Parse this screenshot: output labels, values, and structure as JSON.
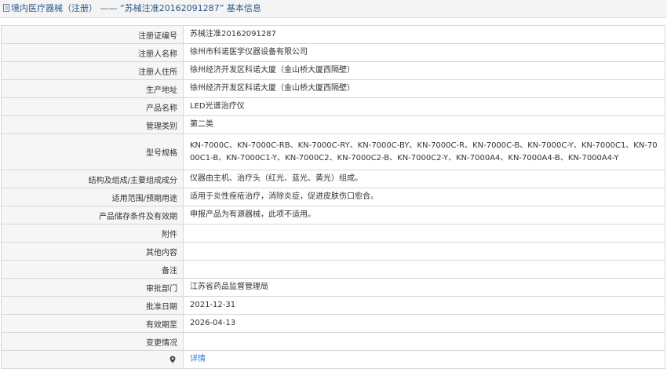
{
  "header": {
    "title": "境内医疗器械（注册） —— “苏械注准20162091287” 基本信息"
  },
  "rows": [
    {
      "label": "注册证编号",
      "value": "苏械注准20162091287"
    },
    {
      "label": "注册人名称",
      "value": "徐州市科诺医学仪器设备有限公司"
    },
    {
      "label": "注册人住所",
      "value": "徐州经济开发区科诺大厦（金山桥大厦西隔壁）"
    },
    {
      "label": "生产地址",
      "value": "徐州经济开发区科诺大厦（金山桥大厦西隔壁）"
    },
    {
      "label": "产品名称",
      "value": "LED光谱治疗仪"
    },
    {
      "label": "管理类别",
      "value": "第二类"
    },
    {
      "label": "型号规格",
      "value": "KN-7000C、KN-7000C-RB、KN-7000C-RY、KN-7000C-BY、KN-7000C-R、KN-7000C-B、KN-7000C-Y、KN-7000C1、KN-7000C1-B、KN-7000C1-Y、KN-7000C2、KN-7000C2-B、KN-7000C2-Y、KN-7000A4、KN-7000A4-B、KN-7000A4-Y"
    },
    {
      "label": "结构及组成/主要组成成分",
      "value": "仪器由主机、治疗头（红光、蓝光、黄光）组成。"
    },
    {
      "label": "适用范围/预期用途",
      "value": "适用于炎性痤疮治疗，消除炎症，促进皮肤伤口愈合。"
    },
    {
      "label": "产品储存条件及有效期",
      "value": "申报产品为有源器械，此项不适用。"
    },
    {
      "label": "附件",
      "value": ""
    },
    {
      "label": "其他内容",
      "value": ""
    },
    {
      "label": "备注",
      "value": ""
    },
    {
      "label": "审批部门",
      "value": "江苏省药品监督管理局"
    },
    {
      "label": "批准日期",
      "value": "2021-12-31"
    },
    {
      "label": "有效期至",
      "value": "2026-04-13"
    },
    {
      "label": "变更情况",
      "value": ""
    }
  ],
  "detail_link": {
    "label": "详情",
    "icon": "location-pin-icon"
  },
  "colors": {
    "link": "#2b7bd0",
    "title": "#2a5a8a",
    "label_bg": "#f6f6f6",
    "border": "#d8d8d8"
  }
}
